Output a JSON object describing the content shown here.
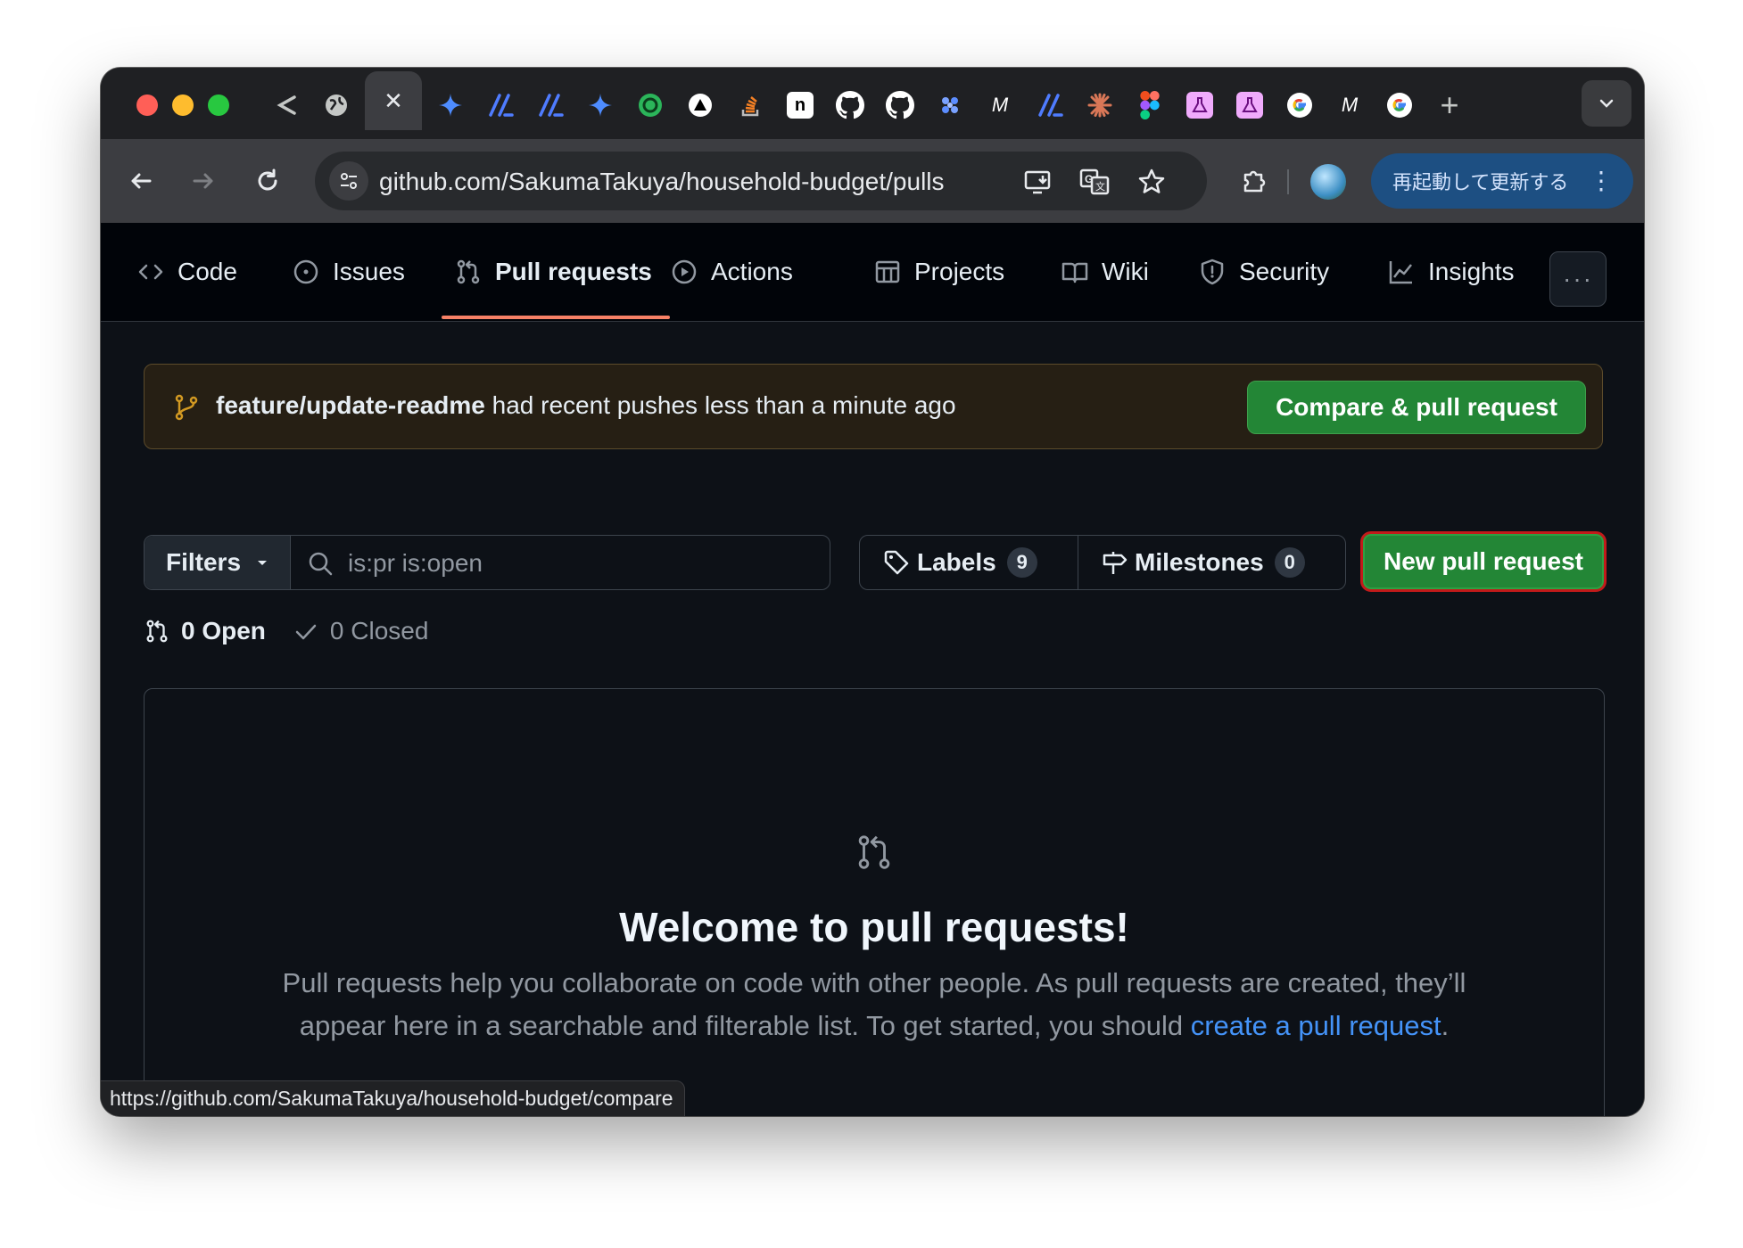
{
  "browser": {
    "tabs": [
      {
        "icon": "share-icon",
        "color": "#c4c7c5"
      },
      {
        "icon": "globe-icon",
        "color": "#c4c7c5"
      },
      {
        "icon": "close-icon",
        "color": "#e8eaed",
        "active": true
      },
      {
        "icon": "gemini-icon",
        "color": "#4e8cff"
      },
      {
        "icon": "slash-app-icon",
        "color": "#4f7cff"
      },
      {
        "icon": "slash-app-icon",
        "color": "#4f7cff"
      },
      {
        "icon": "gemini-icon",
        "color": "#4e8cff"
      },
      {
        "icon": "chatgpt-green-icon",
        "color": "#2bb55a"
      },
      {
        "icon": "triangle-app-icon",
        "color": "#ffffff"
      },
      {
        "icon": "stack-overflow-icon",
        "color": "#f48024"
      },
      {
        "icon": "notion-icon",
        "color": "#ffffff"
      },
      {
        "icon": "github-icon",
        "color": "#ffffff"
      },
      {
        "icon": "github-icon",
        "color": "#ffffff"
      },
      {
        "icon": "slack-like-icon",
        "color": "#7aa2ff"
      },
      {
        "icon": "m-app-icon",
        "color": "#ffffff"
      },
      {
        "icon": "slash-app-icon",
        "color": "#4f7cff"
      },
      {
        "icon": "claude-icon",
        "color": "#d97757"
      },
      {
        "icon": "figma-icon",
        "color": "#f24e1e"
      },
      {
        "icon": "flask-icon",
        "color": "#e879f9"
      },
      {
        "icon": "flask-icon",
        "color": "#e879f9"
      },
      {
        "icon": "google-icon",
        "color": "#ffffff"
      },
      {
        "icon": "m-app-icon",
        "color": "#ffffff"
      },
      {
        "icon": "google-icon",
        "color": "#ffffff"
      }
    ],
    "new_tab": "+",
    "url": "github.com/SakumaTakuya/household-budget/pulls",
    "update_button": "再起動して更新する",
    "status_url": "https://github.com/SakumaTakuya/household-budget/compare"
  },
  "repo_nav": {
    "items": [
      {
        "label": "Code",
        "icon": "code-icon"
      },
      {
        "label": "Issues",
        "icon": "issue-opened-icon"
      },
      {
        "label": "Pull requests",
        "icon": "git-pull-request-icon",
        "active": true
      },
      {
        "label": "Actions",
        "icon": "play-icon"
      },
      {
        "label": "Projects",
        "icon": "table-icon"
      },
      {
        "label": "Wiki",
        "icon": "book-icon"
      },
      {
        "label": "Security",
        "icon": "shield-icon"
      },
      {
        "label": "Insights",
        "icon": "graph-icon"
      }
    ],
    "more": "···"
  },
  "banner": {
    "branch": "feature/update-readme",
    "message": " had recent pushes less than a minute ago",
    "button": "Compare & pull request"
  },
  "filters": {
    "button": "Filters",
    "search_value": "is:pr is:open",
    "labels": "Labels",
    "labels_count": "9",
    "milestones": "Milestones",
    "milestones_count": "0",
    "new_pr": "New pull request"
  },
  "states": {
    "open": "0 Open",
    "closed": "0 Closed"
  },
  "blankslate": {
    "title": "Welcome to pull requests!",
    "body": "Pull requests help you collaborate on code with other people. As pull requests are created, they’ll appear here in a searchable and filterable list. To get started, you should ",
    "link": "create a pull request",
    "end": "."
  },
  "colors": {
    "accent": "#f78166",
    "primary_button": "#238636",
    "link": "#4493f8",
    "highlight_border": "#c21a1a"
  }
}
